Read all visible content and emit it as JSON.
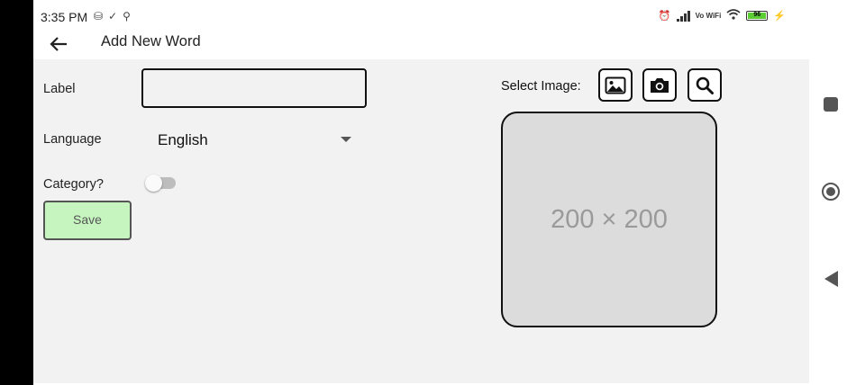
{
  "status_bar": {
    "time": "3:35 PM",
    "left_icons": [
      "sim-icon",
      "check-icon",
      "location-icon"
    ],
    "vowifi": "Vo\nWiFi",
    "battery_level": "96",
    "right_icons": [
      "alarm-icon",
      "signal-icon",
      "wifi-icon",
      "battery-icon",
      "charging-icon"
    ]
  },
  "app_bar": {
    "title": "Add New Word",
    "back_icon": "arrow-left-icon"
  },
  "form": {
    "label_field": {
      "label": "Label",
      "value": "",
      "placeholder": ""
    },
    "language_field": {
      "label": "Language",
      "selected": "English"
    },
    "category_field": {
      "label": "Category?",
      "toggle_on": false
    },
    "save_label": "Save"
  },
  "image_section": {
    "label": "Select Image:",
    "buttons": [
      "gallery-icon",
      "camera-icon",
      "search-icon"
    ],
    "placeholder_text": "200 × 200"
  },
  "system_nav": [
    "recents-square-icon",
    "home-circle-icon",
    "back-triangle-icon"
  ],
  "colors": {
    "save_button_bg": "#c6f5c0",
    "content_bg": "#f2f2f2",
    "placeholder_bg": "#dcdcdc",
    "battery_fill": "#5ccc33"
  }
}
